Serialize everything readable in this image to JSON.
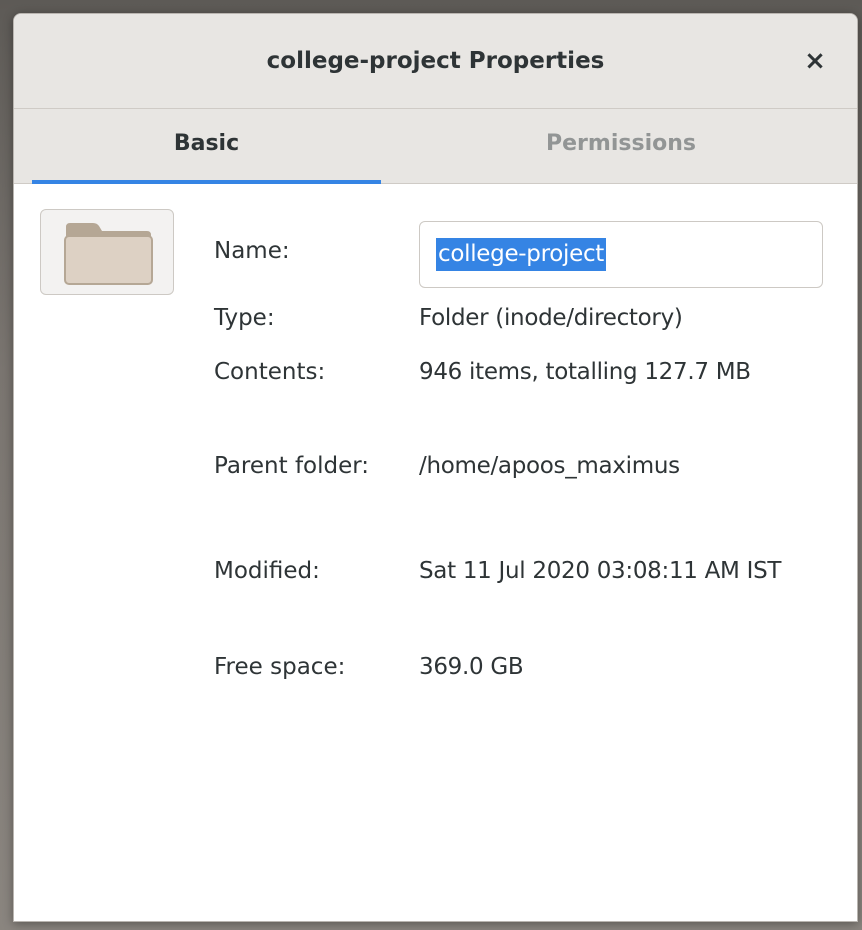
{
  "window": {
    "title": "college-project Properties",
    "close_glyph": "×"
  },
  "tabs": [
    {
      "label": "Basic",
      "active": true
    },
    {
      "label": "Permissions",
      "active": false
    }
  ],
  "file": {
    "icon": "folder-icon",
    "name_label": "Name:",
    "name_value": "college-project",
    "type_label": "Type:",
    "type_value": "Folder (inode/directory)",
    "contents_label": "Contents:",
    "contents_value": "946 items, totalling 127.7 MB",
    "parent_label": "Parent folder:",
    "parent_value": "/home/apoos_maximus",
    "modified_label": "Modified:",
    "modified_value": "Sat 11 Jul 2020 03:08:11 AM IST",
    "free_label": "Free space:",
    "free_value": "369.0 GB"
  },
  "colors": {
    "accent": "#3584e4",
    "header_bg": "#e8e6e3",
    "text": "#2e3436",
    "inactive_tab": "#929595"
  }
}
